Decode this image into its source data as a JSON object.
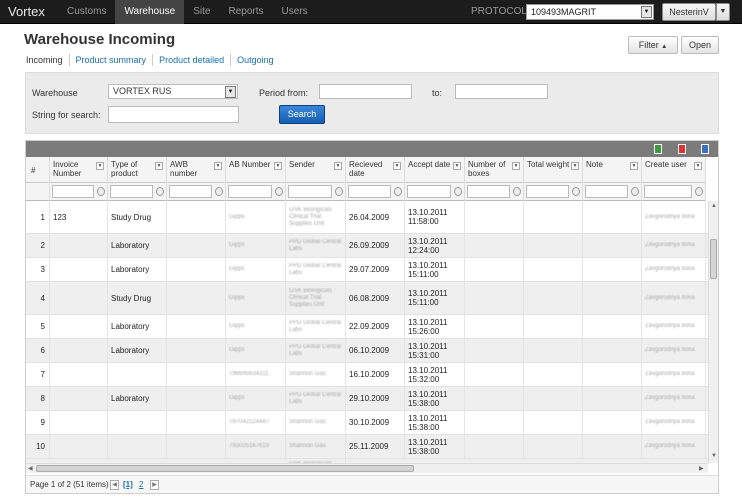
{
  "app": {
    "brand": "Vortex",
    "nav": [
      "Customs",
      "Warehouse",
      "Site",
      "Reports",
      "Users"
    ],
    "active_nav": "Warehouse",
    "protocol_label": "PROTOCOL",
    "protocol_value": "109493MAGRIT",
    "user": "NesterinV"
  },
  "page": {
    "title": "Warehouse Incoming",
    "filter_button": "Filter",
    "open_button": "Open",
    "tabs": [
      "Incoming",
      "Product summary",
      "Product detailed",
      "Outgoing"
    ]
  },
  "filters": {
    "warehouse_label": "Warehouse",
    "warehouse_value": "VORTEX RUS",
    "period_from_label": "Period from:",
    "to_label": "to:",
    "search_label": "String for search:",
    "search_button": "Search"
  },
  "grid": {
    "columns": [
      "#",
      "Invoice Number",
      "Type of product",
      "AWB number",
      "AB Number",
      "Sender",
      "Recieved date",
      "Accept date",
      "Number of boxes",
      "Total weight",
      "Note",
      "Create user"
    ],
    "rows": [
      {
        "n": "1",
        "invoice": "123",
        "type": "Study Drug",
        "awb": "",
        "ab": "Gipps",
        "sender": "GSK Biologicals Clinical Trial Supplies Unit",
        "received": "26.04.2009",
        "accept": "13.10.2011 11:58:00",
        "user": "Zavgorodnya Ilona"
      },
      {
        "n": "2",
        "invoice": "",
        "type": "Laboratory",
        "awb": "",
        "ab": "Gipps",
        "sender": "PPD Global Central Labs",
        "received": "26.09.2009",
        "accept": "13.10.2011 12:24:00",
        "user": "Zavgorodnya Ilona"
      },
      {
        "n": "3",
        "invoice": "",
        "type": "Laboratory",
        "awb": "",
        "ab": "Gipps",
        "sender": "PPD Global Central Labs",
        "received": "29.07.2009",
        "accept": "13.10.2011 15:11:00",
        "user": "Zavgorodnya Ilona"
      },
      {
        "n": "4",
        "invoice": "",
        "type": "Study Drug",
        "awb": "",
        "ab": "Gipps",
        "sender": "GSK Biologicals Clinical Trial Supplies Unit",
        "received": "06.08.2009",
        "accept": "13.10.2011 15:11:00",
        "user": "Zavgorodnya Ilona"
      },
      {
        "n": "5",
        "invoice": "",
        "type": "Laboratory",
        "awb": "",
        "ab": "Gipps",
        "sender": "PPD Global Central Labs",
        "received": "22.09.2009",
        "accept": "13.10.2011 15:26:00",
        "user": "Zavgorodnya Ilona"
      },
      {
        "n": "6",
        "invoice": "",
        "type": "Laboratory",
        "awb": "",
        "ab": "Gipps",
        "sender": "PPD Global Central Labs",
        "received": "06.10.2009",
        "accept": "13.10.2011 15:31:00",
        "user": "Zavgorodnya Ilona"
      },
      {
        "n": "7",
        "invoice": "",
        "type": "",
        "awb": "",
        "ab": "796695634311",
        "sender": "Shannon Gas",
        "received": "16.10.2009",
        "accept": "13.10.2011 15:32:00",
        "user": "Zavgorodnya Ilona"
      },
      {
        "n": "8",
        "invoice": "",
        "type": "Laboratory",
        "awb": "",
        "ab": "Gipps",
        "sender": "PPD Global Central Labs",
        "received": "29.10.2009",
        "accept": "13.10.2011 15:38:00",
        "user": "Zavgorodnya Ilona"
      },
      {
        "n": "9",
        "invoice": "",
        "type": "",
        "awb": "",
        "ab": "797042124487",
        "sender": "Shannon Gas",
        "received": "30.10.2009",
        "accept": "13.10.2011 15:38:00",
        "user": "Zavgorodnya Ilona"
      },
      {
        "n": "10",
        "invoice": "",
        "type": "",
        "awb": "",
        "ab": "793025167619",
        "sender": "Shannon Gas",
        "received": "25.11.2009",
        "accept": "13.10.2011 15:38:00",
        "user": "Zavgorodnya Ilona"
      }
    ],
    "partial_row_sender": "GSK Biologicals"
  },
  "pager": {
    "info": "Page 1 of 2 (51 items)",
    "current": "[1]",
    "next": "2"
  }
}
